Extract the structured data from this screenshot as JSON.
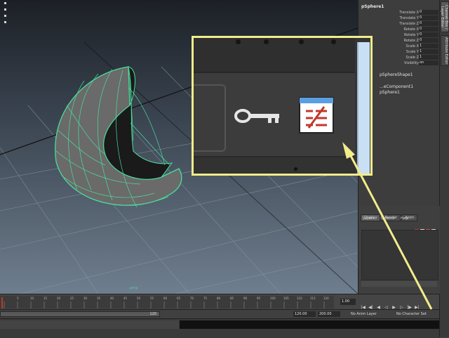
{
  "viewport": {
    "camera_label": "persp"
  },
  "channel_box": {
    "object_name": "pSphere1",
    "attributes": [
      {
        "label": "Translate X",
        "value": "0"
      },
      {
        "label": "Translate Y",
        "value": "0"
      },
      {
        "label": "Translate Z",
        "value": "0"
      },
      {
        "label": "Rotate X",
        "value": "0"
      },
      {
        "label": "Rotate Y",
        "value": "0"
      },
      {
        "label": "Rotate Z",
        "value": "0"
      },
      {
        "label": "Scale X",
        "value": "1"
      },
      {
        "label": "Scale Y",
        "value": "1"
      },
      {
        "label": "Scale Z",
        "value": "1"
      },
      {
        "label": "Visibility",
        "value": "on"
      }
    ],
    "shape_node": "pSphereShape1",
    "input_node_1": "...eComponent1",
    "input_node_2": "pSphere1"
  },
  "side_tabs": {
    "channel_box_tab": "Channel Box / Layer Editor",
    "attribute_editor_tab": "Attribute Editor"
  },
  "layer_panel": {
    "tabs": [
      "Display",
      "Render",
      "Anim"
    ],
    "menu": [
      "Layers",
      "Options",
      "Help"
    ]
  },
  "timeline": {
    "tick_labels": [
      "5",
      "10",
      "15",
      "20",
      "25",
      "30",
      "35",
      "40",
      "45",
      "50",
      "55",
      "60",
      "65",
      "70",
      "75",
      "80",
      "85",
      "90",
      "95",
      "100",
      "105",
      "110",
      "115",
      "120"
    ],
    "current_frame": "1.00"
  },
  "range_bar": {
    "slider_end_label": "120",
    "end_time": "120.00",
    "end_range": "200.00",
    "anim_layer": "No Anim Layer",
    "character_set": "No Character Set"
  },
  "zoom_callout": {
    "highlight_color": "#f2ec8a"
  },
  "colors": {
    "wireframe": "#4ade9c",
    "highlight": "#f2ec8a"
  }
}
